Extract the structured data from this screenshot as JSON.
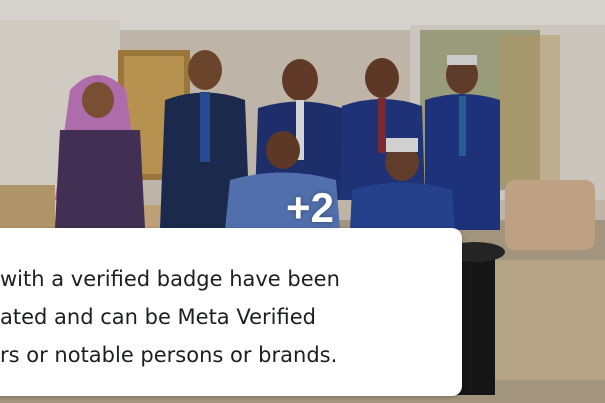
{
  "photo": {
    "more_count": "+2"
  },
  "tooltip": {
    "lines": [
      "with a verified badge have been",
      "ated and can be Meta Verified",
      "rs or notable persons or brands."
    ]
  }
}
